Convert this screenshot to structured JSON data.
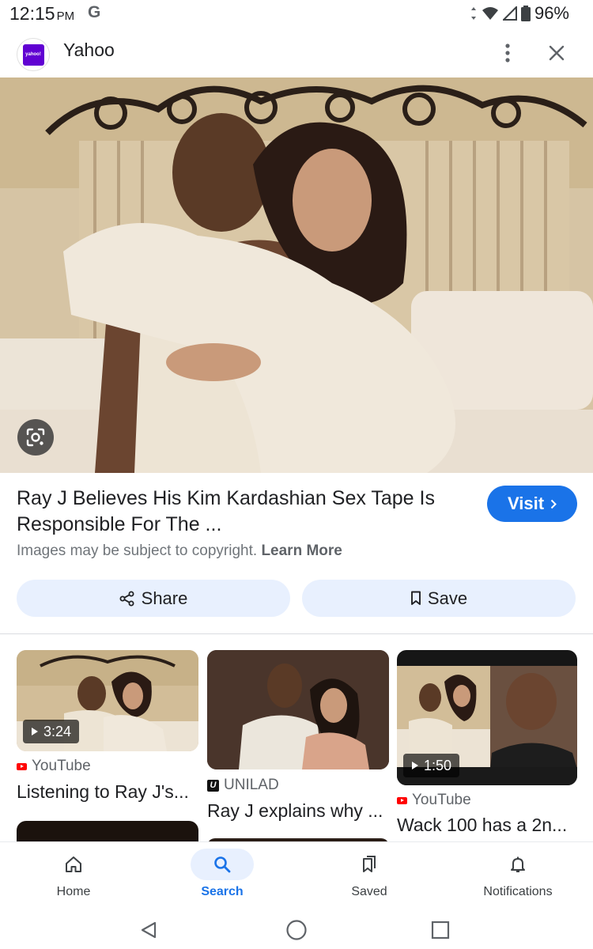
{
  "status_bar": {
    "time": "12:15",
    "ampm": "PM",
    "g_badge": "G",
    "battery": "96%"
  },
  "source": {
    "favicon_text": "yahoo!",
    "name": "Yahoo",
    "more_icon": "more-vert-icon",
    "close_icon": "close-icon"
  },
  "image": {
    "lens_icon": "google-lens-icon"
  },
  "result": {
    "title": "Ray J Believes His Kim Kardashian Sex Tape Is Responsible For The ...",
    "visit_label": "Visit",
    "copyright_text": "Images may be subject to copyright.",
    "learn_more": "Learn More",
    "share_label": "Share",
    "save_label": "Save"
  },
  "related": [
    {
      "duration": "3:24",
      "source": "YouTube",
      "title": "Listening to Ray J's..."
    },
    {
      "duration": "",
      "source": "UNILAD",
      "title": "Ray J explains why ..."
    },
    {
      "duration": "1:50",
      "source": "YouTube",
      "title": "Wack 100 has a 2n..."
    }
  ],
  "bottom_nav": {
    "items": [
      {
        "label": "Home",
        "icon": "home-icon",
        "active": false
      },
      {
        "label": "Search",
        "icon": "search-icon",
        "active": true
      },
      {
        "label": "Saved",
        "icon": "saved-icon",
        "active": false
      },
      {
        "label": "Notifications",
        "icon": "bell-icon",
        "active": false
      }
    ]
  },
  "colors": {
    "accent": "#1a73e8",
    "pill_bg": "#e8f0fe",
    "youtube_red": "#ff0000",
    "yahoo_purple": "#6001d2"
  }
}
